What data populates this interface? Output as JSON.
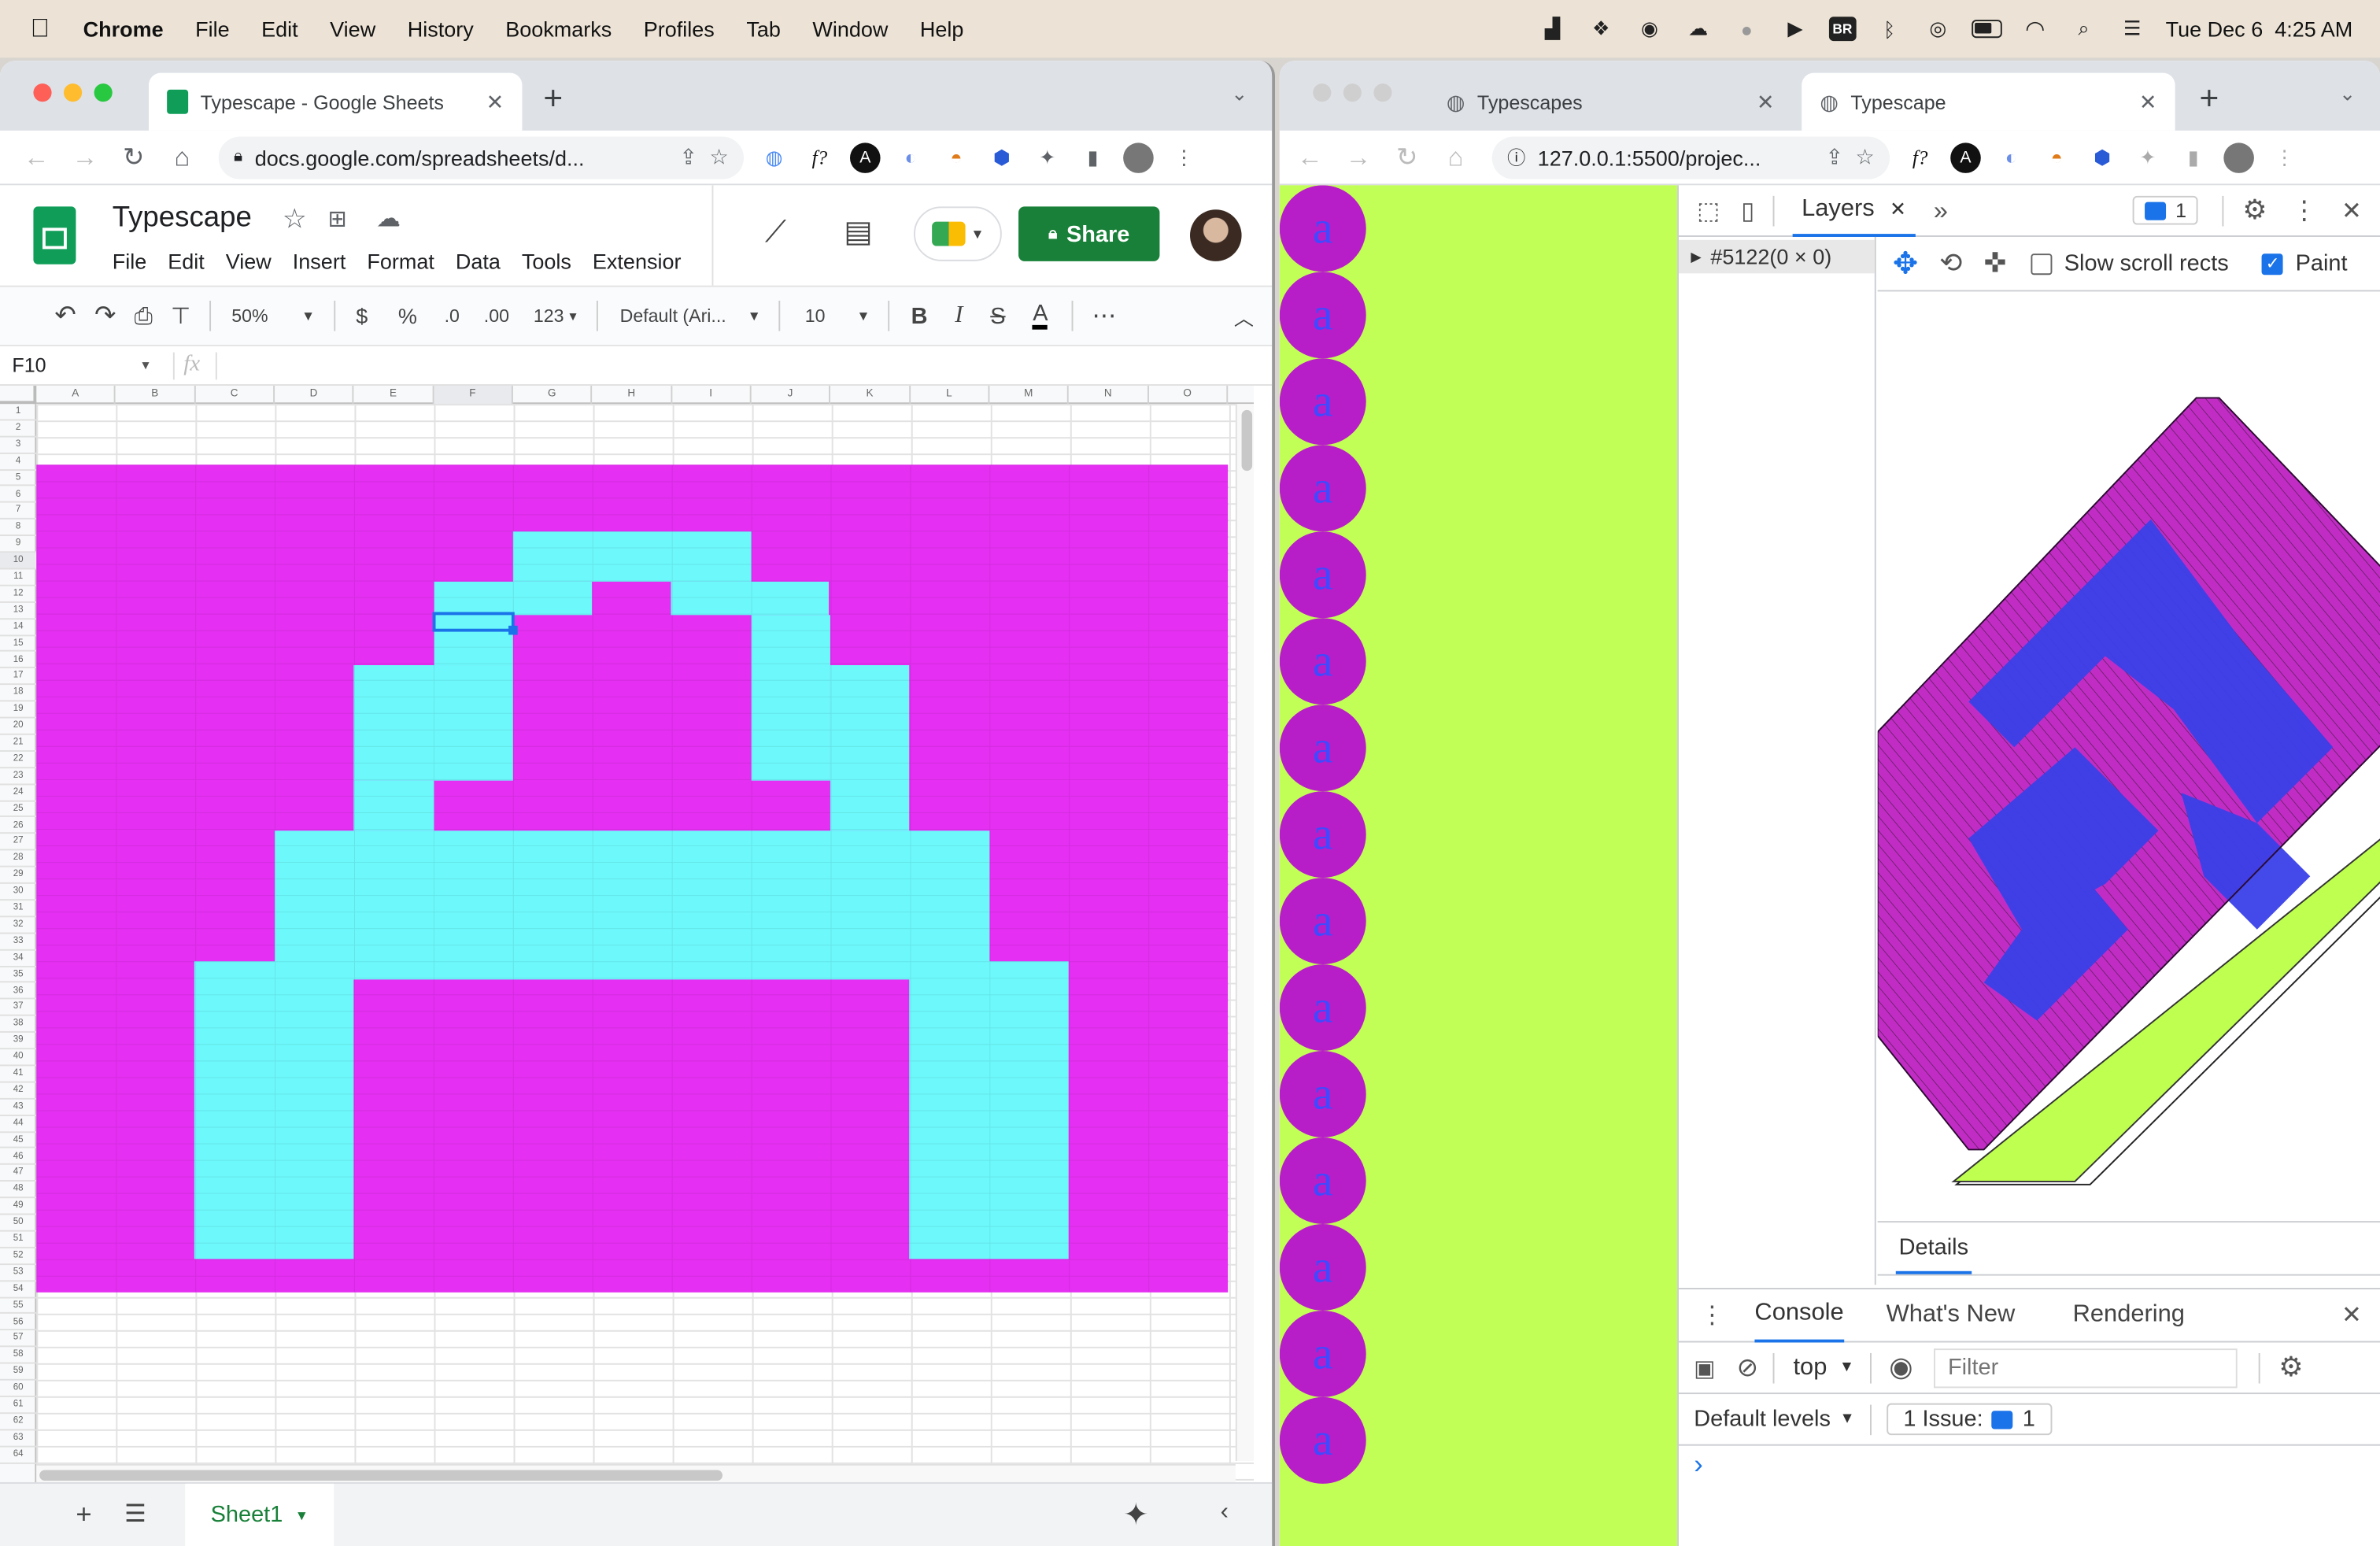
{
  "menubar": {
    "apple": "",
    "items": [
      "Chrome",
      "File",
      "Edit",
      "View",
      "History",
      "Bookmarks",
      "Profiles",
      "Tab",
      "Window",
      "Help"
    ],
    "datetime": "Tue Dec 6  4:25 AM",
    "status_icons": [
      "activity-monitor-icon",
      "dropbox-icon",
      "obs-icon",
      "creative-cloud-icon",
      "globe-icon",
      "play-icon",
      "br-badge-icon",
      "bluetooth-icon",
      "user-circle-icon",
      "battery-icon",
      "wifi-icon",
      "spotlight-icon",
      "control-center-icon"
    ],
    "br_badge": "BR"
  },
  "left_window": {
    "tab_title": "Typescape - Google Sheets",
    "new_tab": "+",
    "url": "docs.google.com/spreadsheets/d...",
    "sheets": {
      "doc_title": "Typescape",
      "menus": [
        "File",
        "Edit",
        "View",
        "Insert",
        "Format",
        "Data",
        "Tools",
        "Extensior"
      ],
      "share_label": "Share",
      "toolbar": {
        "zoom": "50%",
        "currency": "$",
        "percent": "%",
        "dec_less": ".0",
        "dec_more": ".00",
        "format": "123",
        "font": "Default (Ari...",
        "font_size": "10",
        "bold": "B",
        "italic": "I",
        "strike": "S",
        "text_color": "A",
        "more": "⋯"
      },
      "name_box": "F10",
      "fx": "fx",
      "sheet_tab": "Sheet1",
      "columns": [
        "A",
        "B",
        "C",
        "D",
        "E",
        "F",
        "G",
        "H",
        "I",
        "J",
        "K",
        "L",
        "M",
        "N",
        "O"
      ],
      "row_count": 64,
      "art_rows": 50,
      "background_color": "#e52ff2",
      "glyph_color": "#6df8fb",
      "selected_cell": {
        "row": 10,
        "col": "F"
      }
    }
  },
  "right_window": {
    "tabs": [
      {
        "title": "Typescapes",
        "active": false
      },
      {
        "title": "Typescape",
        "active": true
      }
    ],
    "url": "127.0.0.1:5500/projec...",
    "page": {
      "circle_letter": "a",
      "circle_count": 15,
      "bg_color": "#c2ff56",
      "circle_color": "#b81ec8",
      "letter_color": "#3f49ff"
    },
    "devtools": {
      "panel_tab": "Layers",
      "issues_count": "1",
      "layer_item": "#5122(0 × 0)",
      "slow_scroll_label": "Slow scroll rects",
      "paint_label": "Paint",
      "details_label": "Details",
      "drawer_tabs": [
        "Console",
        "What's New",
        "Rendering"
      ],
      "context": "top",
      "filter_placeholder": "Filter",
      "levels": "Default levels",
      "issue_label": "1 Issue:",
      "issue_count": "1",
      "prompt": "›"
    }
  }
}
